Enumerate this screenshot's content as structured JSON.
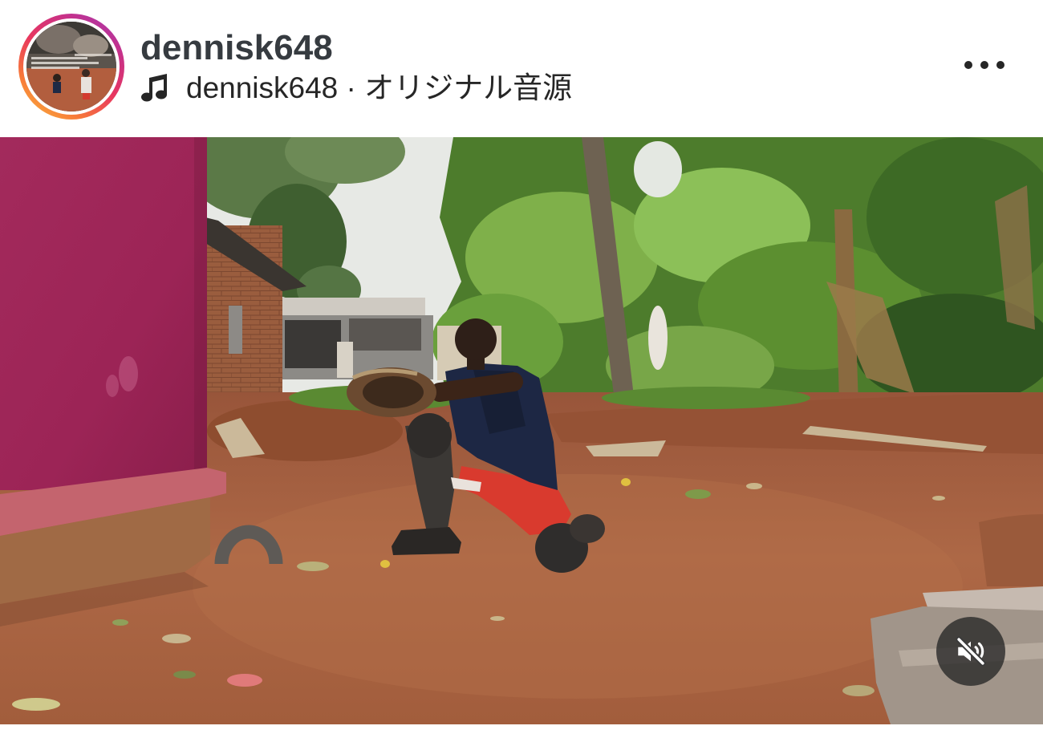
{
  "header": {
    "username": "dennisk648",
    "audio_label": "dennisk648 · オリジナル音源"
  },
  "icons": {
    "avatar": "story-ring-avatar",
    "music": "music-note-icon",
    "more": "more-options-icon",
    "mute": "muted-speaker-icon"
  },
  "colors": {
    "story_ring": [
      "#fbbf3c",
      "#f7783a",
      "#e8375f",
      "#c93187",
      "#9d39b8"
    ],
    "username": "#363b40",
    "text": "#262626",
    "mute_button_bg": "rgba(38,38,38,0.78)"
  },
  "video": {
    "muted": true
  }
}
